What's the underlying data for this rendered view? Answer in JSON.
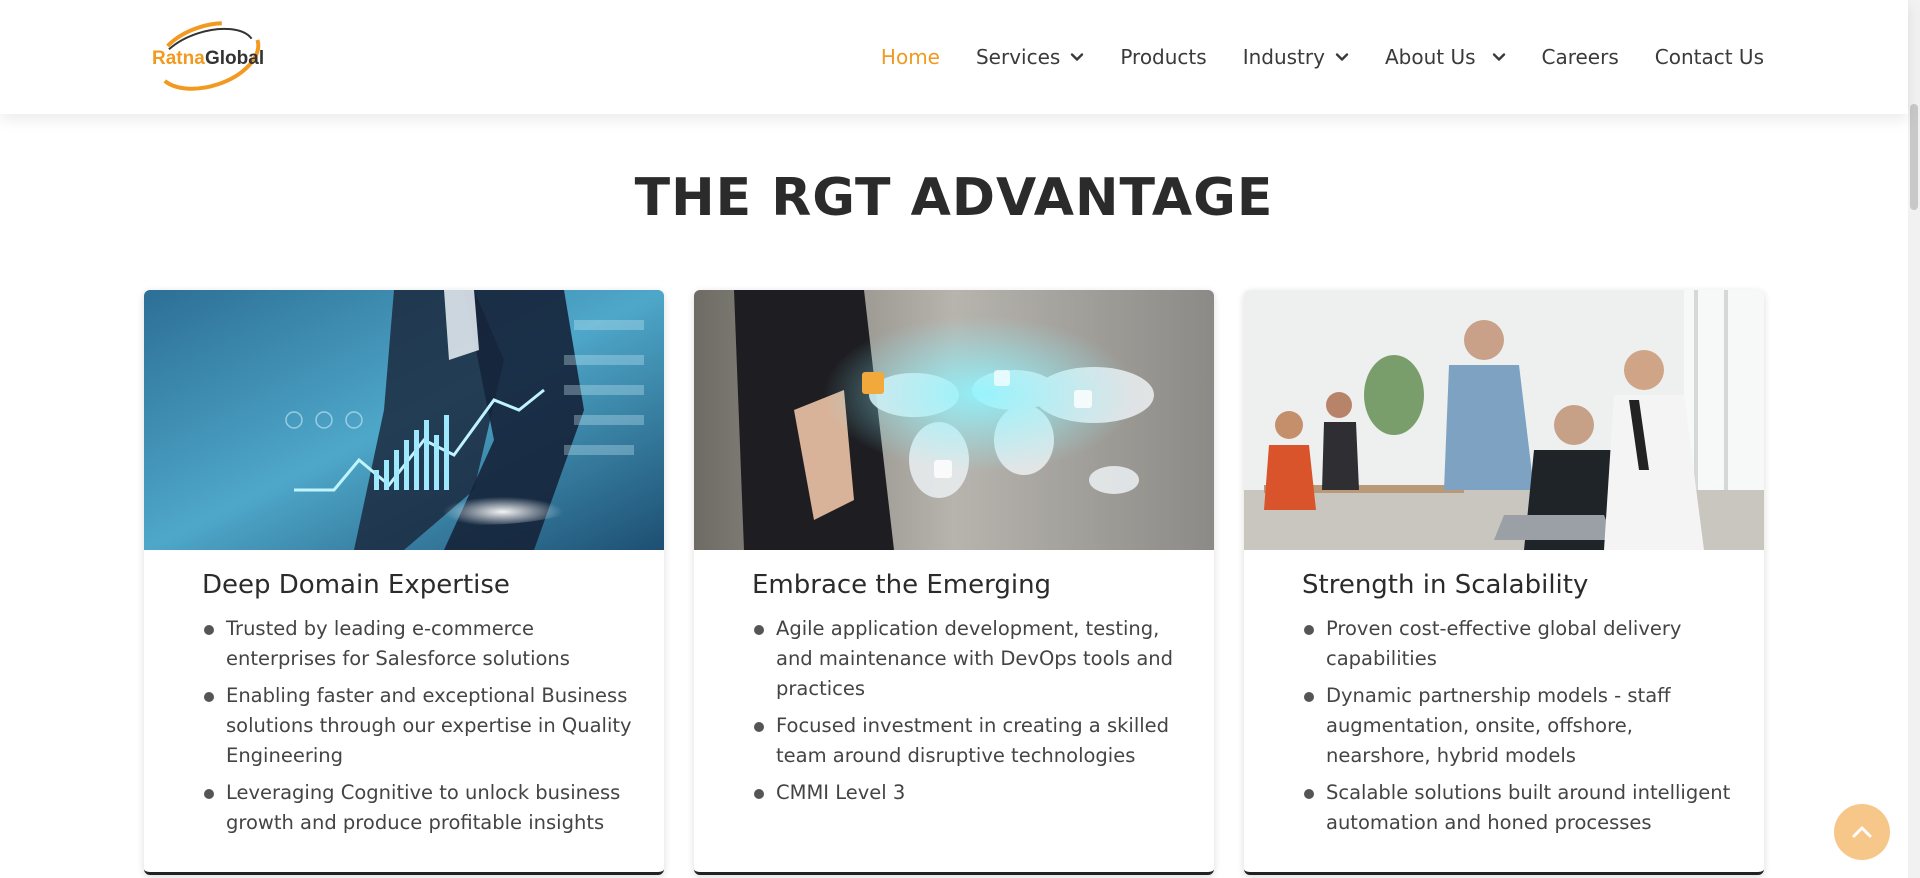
{
  "brand": {
    "logo_text_1": "Ratna",
    "logo_text_2": "Global",
    "accent_color": "#f29a1f"
  },
  "nav": {
    "items": [
      {
        "label": "Home",
        "active": true,
        "has_dropdown": false
      },
      {
        "label": "Services",
        "active": false,
        "has_dropdown": true
      },
      {
        "label": "Products",
        "active": false,
        "has_dropdown": false
      },
      {
        "label": "Industry",
        "active": false,
        "has_dropdown": true
      },
      {
        "label": "About Us",
        "active": false,
        "has_dropdown": true
      },
      {
        "label": "Careers",
        "active": false,
        "has_dropdown": false
      },
      {
        "label": "Contact Us",
        "active": false,
        "has_dropdown": false
      }
    ]
  },
  "section": {
    "title": "THE RGT ADVANTAGE"
  },
  "cards": [
    {
      "image": "business-analytics-photo",
      "title": "Deep Domain Expertise",
      "points": [
        "Trusted by leading e-commerce enterprises for Salesforce solutions",
        "Enabling faster and exceptional Business solutions through our expertise in Quality Engineering",
        "Leveraging Cognitive to unlock business growth and produce profitable insights"
      ]
    },
    {
      "image": "world-map-touch-photo",
      "title": "Embrace the Emerging",
      "points": [
        "Agile application development, testing, and maintenance with DevOps tools and practices",
        "Focused investment in creating a skilled team around disruptive technologies",
        "CMMI Level 3"
      ]
    },
    {
      "image": "team-office-photo",
      "title": "Strength in Scalability",
      "points": [
        "Proven cost-effective global delivery capabilities",
        "Dynamic partnership models - staff augmentation, onsite, offshore, nearshore, hybrid models",
        "Scalable solutions built around intelligent automation and honed processes"
      ]
    }
  ],
  "back_to_top": {
    "icon": "chevron-up-icon",
    "color": "#f7c78a"
  }
}
